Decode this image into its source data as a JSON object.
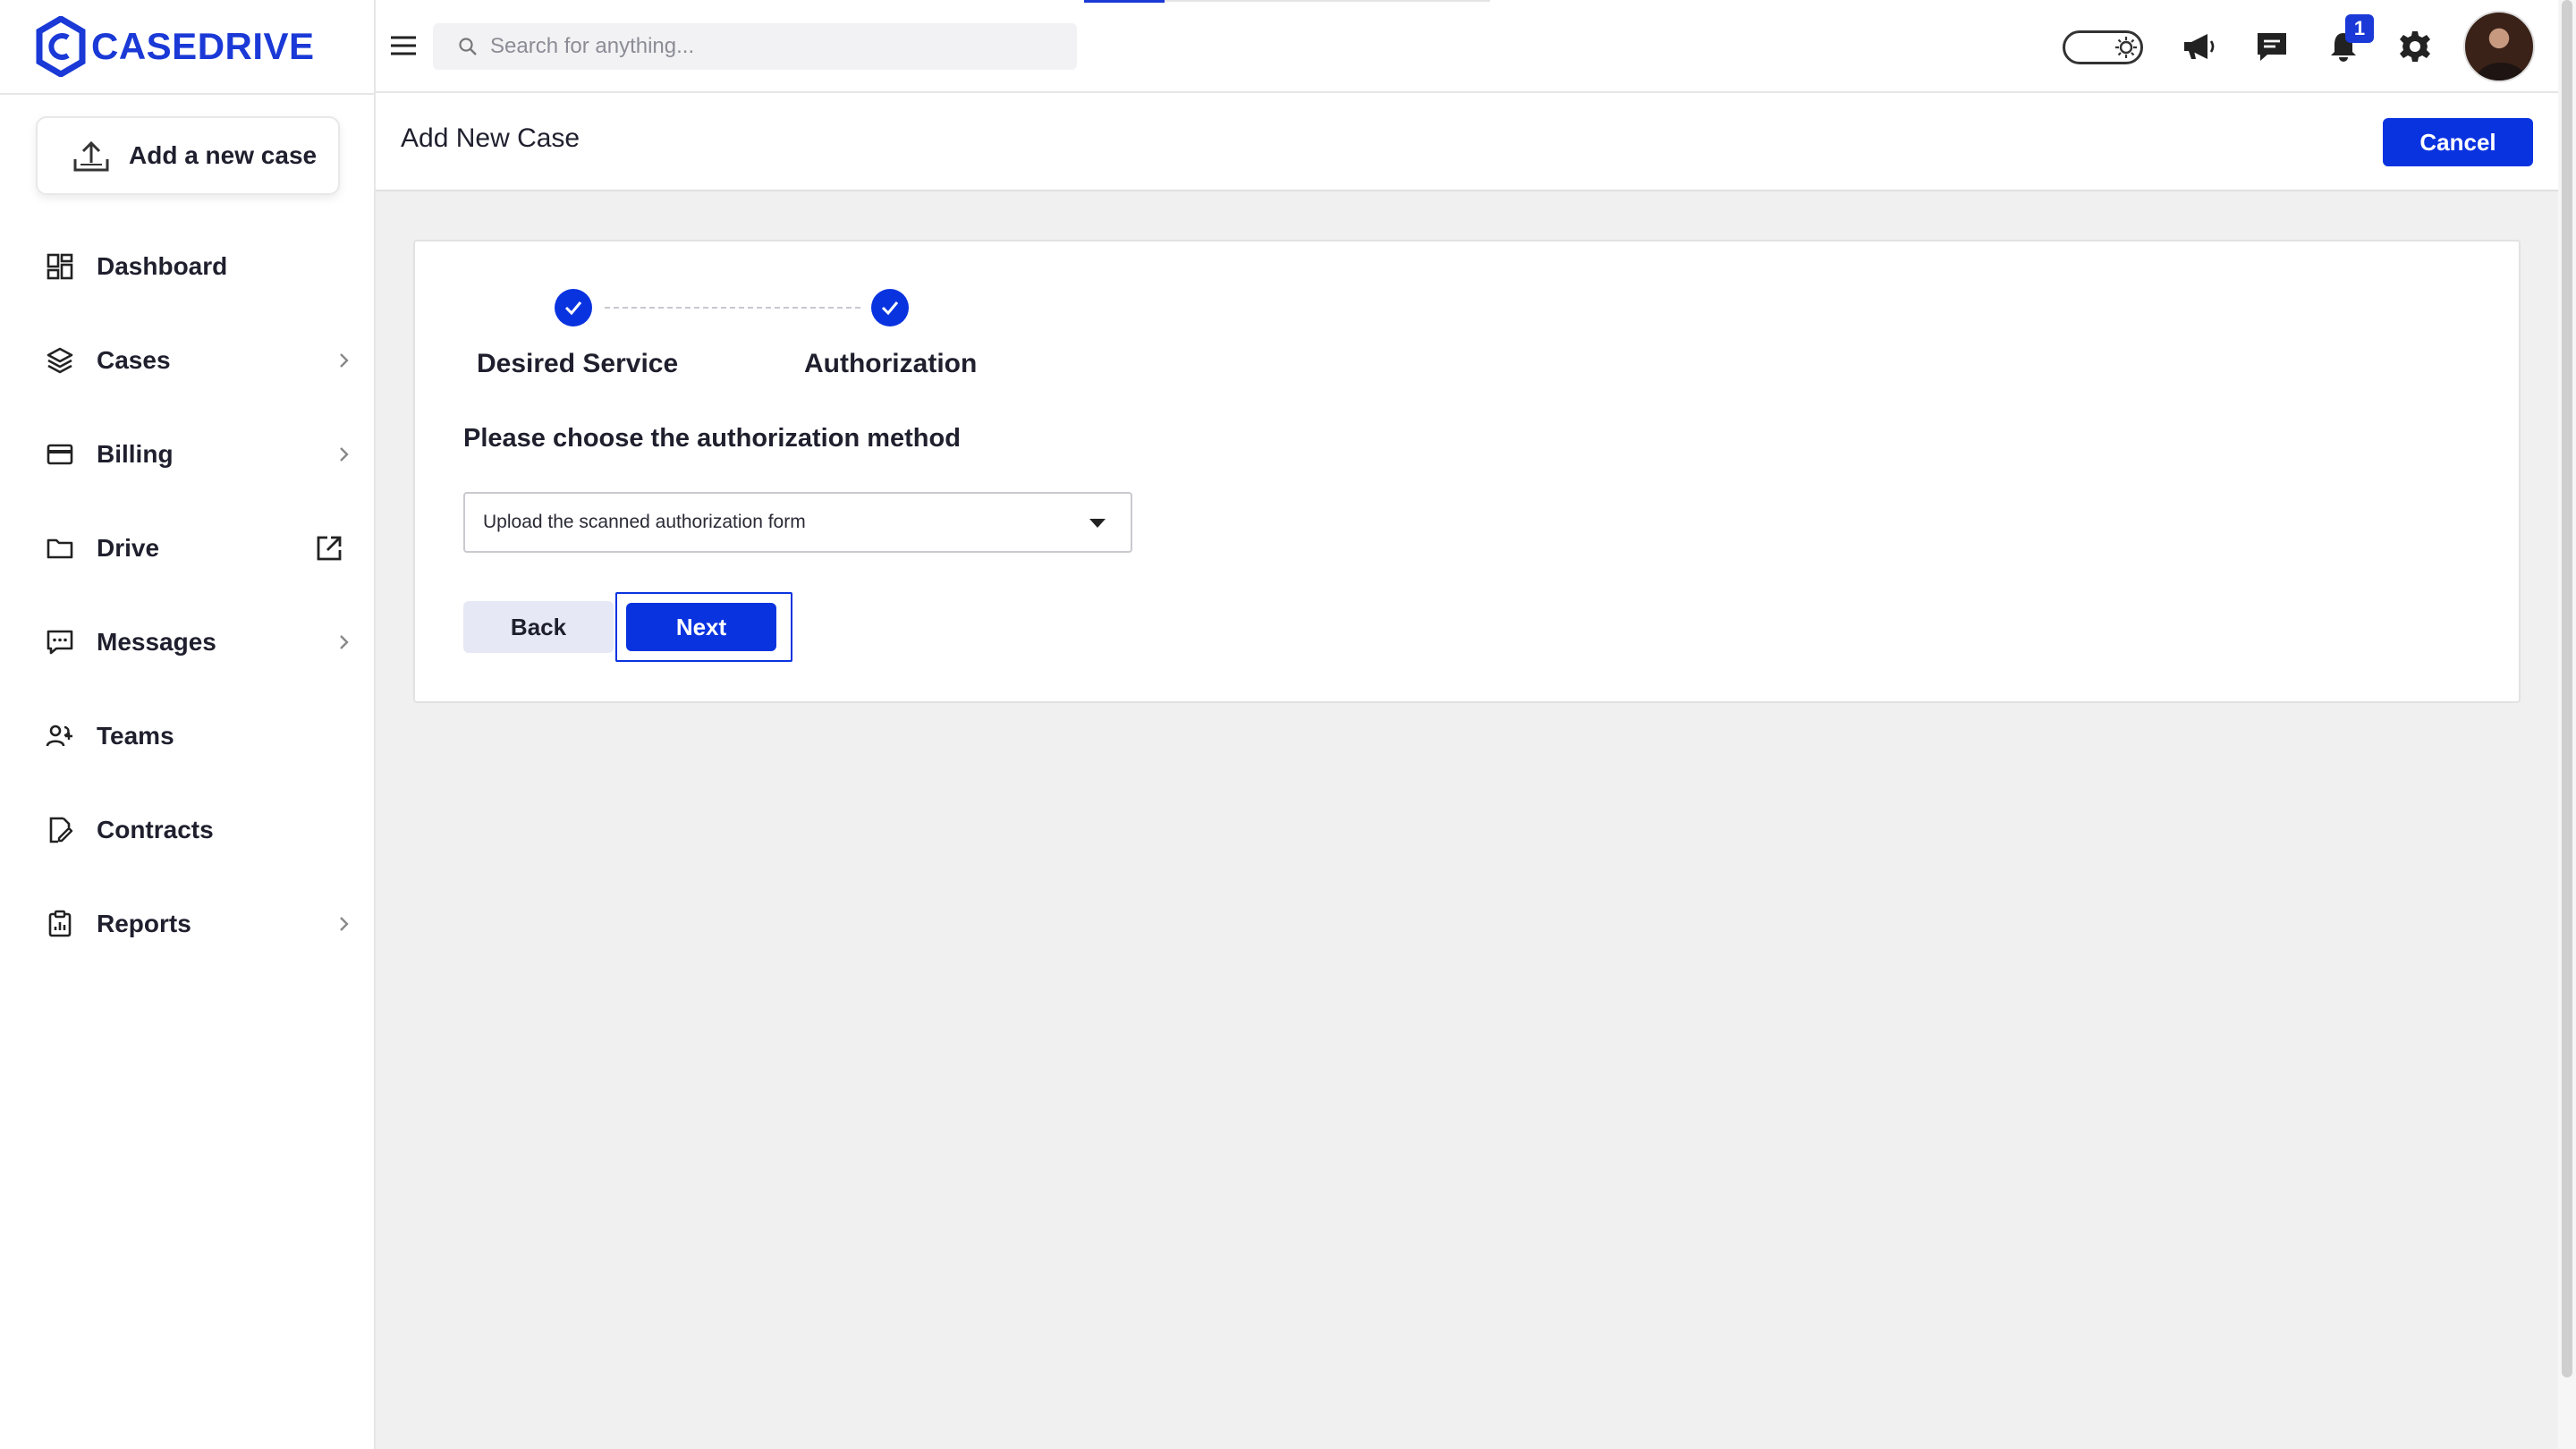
{
  "brand": {
    "name": "CASEDRIVE",
    "color": "#1a39d6"
  },
  "sidebar": {
    "add_case_label": "Add a new case",
    "items": [
      {
        "label": "Dashboard",
        "icon": "dashboard-icon",
        "has_chevron": false
      },
      {
        "label": "Cases",
        "icon": "layers-icon",
        "has_chevron": true
      },
      {
        "label": "Billing",
        "icon": "credit-card-icon",
        "has_chevron": true
      },
      {
        "label": "Drive",
        "icon": "folder-icon",
        "external": true
      },
      {
        "label": "Messages",
        "icon": "message-icon",
        "has_chevron": true
      },
      {
        "label": "Teams",
        "icon": "users-icon",
        "has_chevron": false
      },
      {
        "label": "Contracts",
        "icon": "contract-icon",
        "has_chevron": false
      },
      {
        "label": "Reports",
        "icon": "clipboard-icon",
        "has_chevron": true
      }
    ]
  },
  "topbar": {
    "search_placeholder": "Search for anything...",
    "notification_count": "1",
    "icons": [
      "menu-icon",
      "theme-toggle",
      "megaphone-icon",
      "chat-icon",
      "bell-icon",
      "gear-icon",
      "avatar"
    ]
  },
  "page": {
    "title": "Add New Case",
    "cancel_label": "Cancel"
  },
  "wizard": {
    "steps": [
      {
        "label": "Desired Service",
        "completed": true
      },
      {
        "label": "Authorization",
        "completed": true
      }
    ],
    "question": "Please choose the authorization method",
    "select_value": "Upload the scanned authorization form",
    "back_label": "Back",
    "next_label": "Next"
  },
  "colors": {
    "primary": "#0a33e0",
    "background": "#f0f0f0",
    "back_button": "#e6e9f5"
  }
}
